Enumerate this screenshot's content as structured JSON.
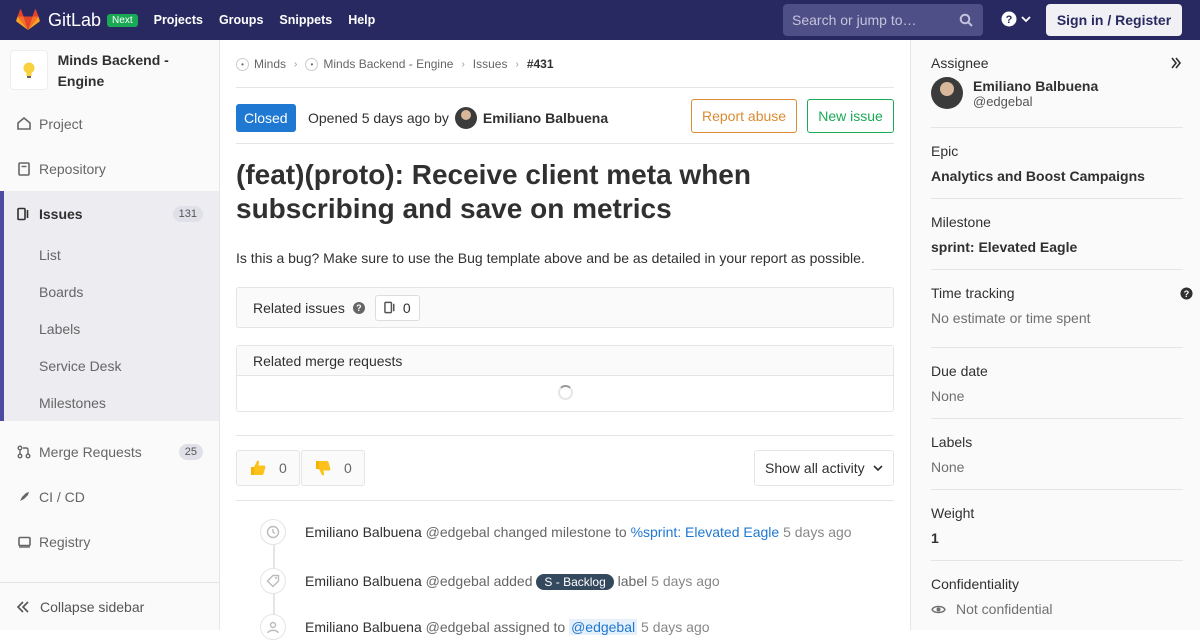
{
  "topbar": {
    "logo_text": "GitLab",
    "next_badge": "Next",
    "nav": [
      "Projects",
      "Groups",
      "Snippets",
      "Help"
    ],
    "search_placeholder": "Search or jump to…",
    "sign_in": "Sign in / Register"
  },
  "sidebar": {
    "project_name": "Minds Backend - Engine",
    "items": {
      "project": "Project",
      "repository": "Repository",
      "issues": "Issues",
      "issues_count": "131",
      "merge_requests": "Merge Requests",
      "mr_count": "25",
      "cicd": "CI / CD",
      "registry": "Registry"
    },
    "sub_items": [
      "List",
      "Boards",
      "Labels",
      "Service Desk",
      "Milestones"
    ],
    "collapse": "Collapse sidebar"
  },
  "breadcrumb": [
    "Minds",
    "Minds Backend - Engine",
    "Issues",
    "#431"
  ],
  "issue": {
    "status": "Closed",
    "opened_prefix": "Opened 5 days ago by",
    "author": "Emiliano Balbuena",
    "report_abuse": "Report abuse",
    "new_issue": "New issue",
    "title": "(feat)(proto): Receive client meta when subscribing and save on metrics",
    "description": "Is this a bug? Make sure to use the Bug template above and be as detailed in your report as possible."
  },
  "related_issues": {
    "label": "Related issues",
    "count": "0"
  },
  "related_mrs": {
    "label": "Related merge requests"
  },
  "awards": {
    "thumbs_up": "0",
    "thumbs_down": "0"
  },
  "activity_filter": "Show all activity",
  "timeline": [
    {
      "author": "Emiliano Balbuena",
      "user": "@edgebal",
      "action": "changed milestone to",
      "target": "%sprint: Elevated Eagle",
      "time": "5 days ago"
    },
    {
      "author": "Emiliano Balbuena",
      "user": "@edgebal",
      "action": "added",
      "label": "S - Backlog",
      "suffix": "label",
      "time": "5 days ago"
    },
    {
      "author": "Emiliano Balbuena",
      "user": "@edgebal",
      "action": "assigned to",
      "target": "@edgebal",
      "time": "5 days ago"
    }
  ],
  "right_sidebar": {
    "assignee_label": "Assignee",
    "assignee_name": "Emiliano Balbuena",
    "assignee_user": "@edgebal",
    "epic_label": "Epic",
    "epic_value": "Analytics and Boost Campaigns",
    "milestone_label": "Milestone",
    "milestone_value": "sprint: Elevated Eagle",
    "time_label": "Time tracking",
    "time_value": "No estimate or time spent",
    "due_label": "Due date",
    "due_value": "None",
    "labels_label": "Labels",
    "labels_value": "None",
    "weight_label": "Weight",
    "weight_value": "1",
    "conf_label": "Confidentiality",
    "conf_value": "Not confidential"
  }
}
